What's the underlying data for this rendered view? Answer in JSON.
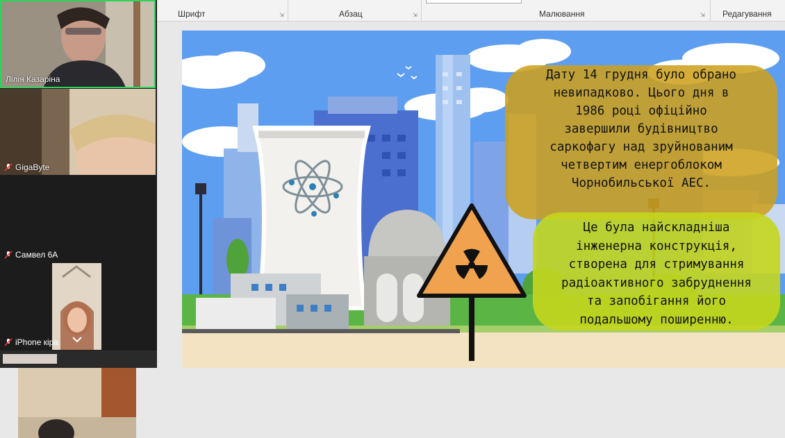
{
  "participants": [
    {
      "name": "Лілія Казаріна",
      "muted": false
    },
    {
      "name": "GigaByte",
      "muted": true
    },
    {
      "name": "Самвел 6А",
      "muted": true
    },
    {
      "name": "iPhone кіра",
      "muted": true
    }
  ],
  "ribbon": {
    "groups": [
      "Шрифт",
      "Абзац",
      "Малювання",
      "Редагування"
    ]
  },
  "slide": {
    "text_1": [
      "Дату 14 грудня було обрано",
      "невипадково. Цього дня в",
      "1986 році офіційно",
      "завершили будівництво",
      "саркофагу над зруйнованим",
      "четвертим енергоблоком",
      "Чорнобильської АЕС."
    ],
    "text_2": [
      "Це була найскладніша",
      "інженерна конструкція,",
      "створена для стримування",
      "радіоактивного забруднення",
      "та запобігання його",
      "подальшому поширенню."
    ]
  },
  "colors": {
    "sky": "#5d9ef0",
    "bubble_1": "#cda01e",
    "bubble_2": "#c4d61e",
    "active_speaker_border": "#2dd35c"
  }
}
